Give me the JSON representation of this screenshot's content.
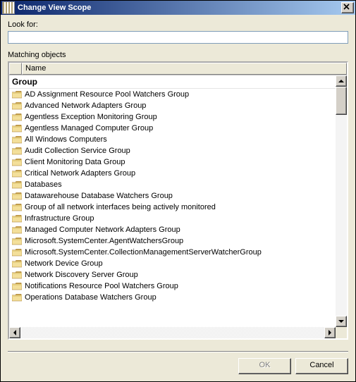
{
  "window": {
    "title": "Change View Scope"
  },
  "search": {
    "label": "Look for:",
    "value": "",
    "placeholder": ""
  },
  "list": {
    "caption": "Matching objects",
    "columns": {
      "icon": "",
      "name": "Name"
    },
    "group_header": "Group",
    "items": [
      "AD Assignment Resource Pool Watchers Group",
      "Advanced Network Adapters Group",
      "Agentless Exception Monitoring Group",
      "Agentless Managed Computer Group",
      "All Windows Computers",
      "Audit Collection Service Group",
      "Client Monitoring Data Group",
      "Critical Network Adapters Group",
      "Databases",
      "Datawarehouse Database Watchers Group",
      "Group of all network interfaces being actively monitored",
      "Infrastructure Group",
      "Managed Computer Network Adapters Group",
      "Microsoft.SystemCenter.AgentWatchersGroup",
      "Microsoft.SystemCenter.CollectionManagementServerWatcherGroup",
      "Network Device Group",
      "Network Discovery Server Group",
      "Notifications Resource Pool Watchers Group",
      "Operations Database Watchers Group"
    ]
  },
  "buttons": {
    "ok": "OK",
    "cancel": "Cancel"
  }
}
